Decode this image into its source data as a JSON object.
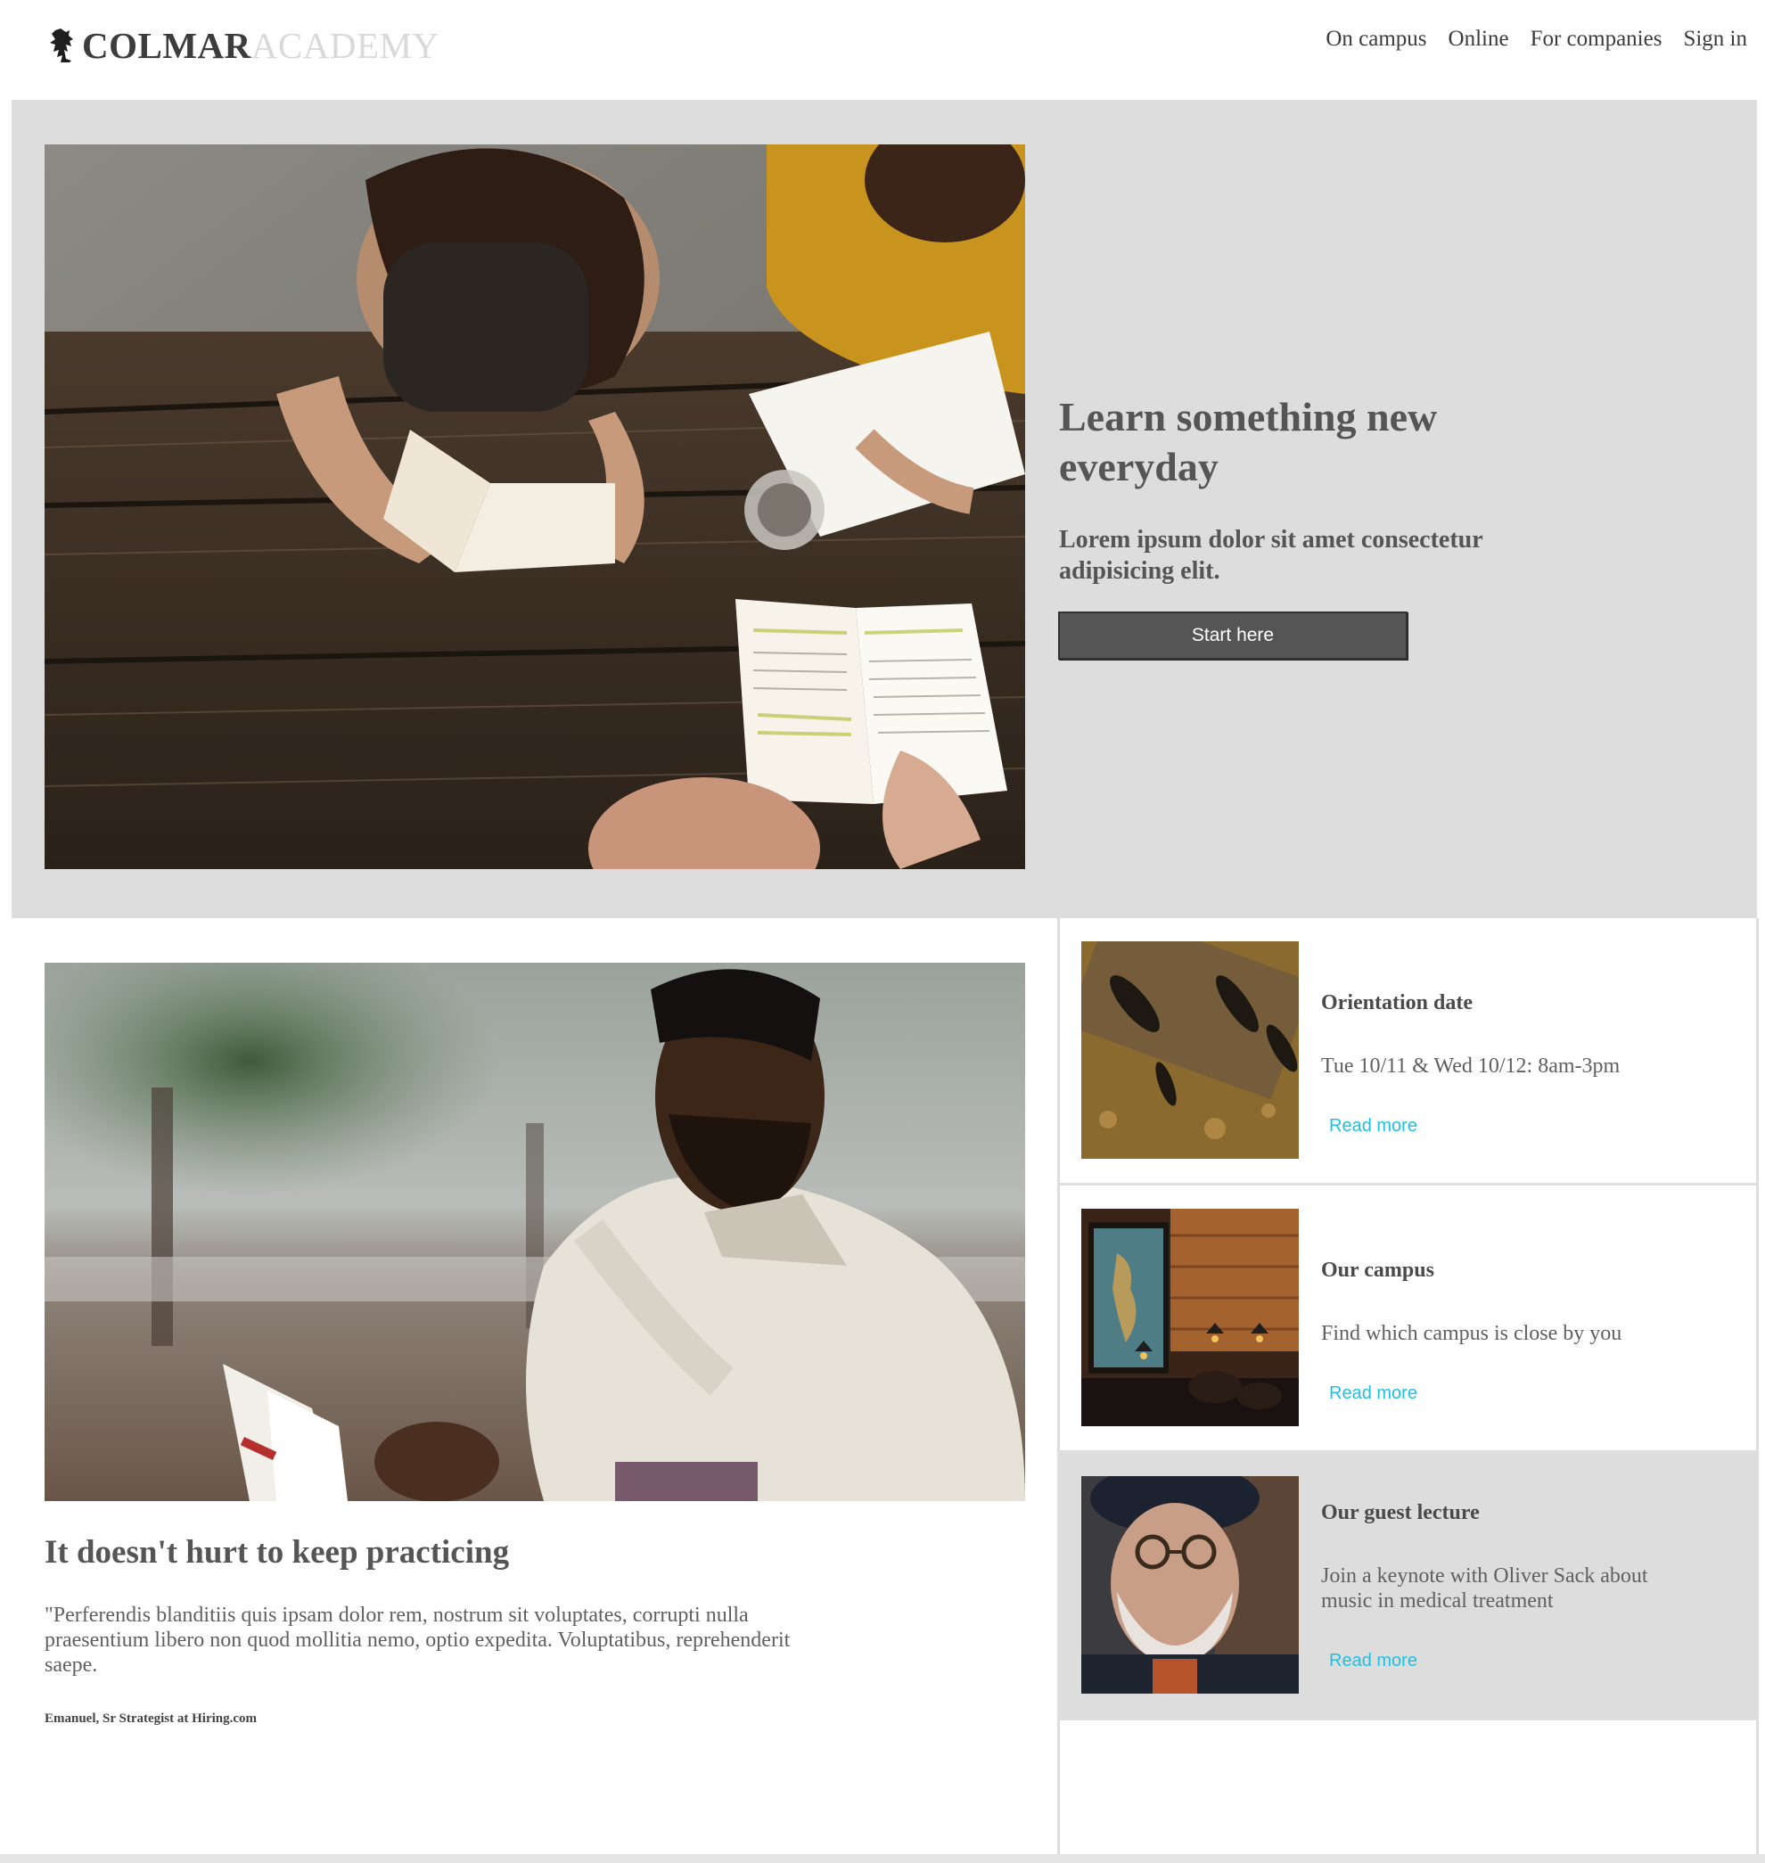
{
  "brand": {
    "name_bold": "COLMAR",
    "name_light": "ACADEMY"
  },
  "nav": {
    "items": [
      {
        "label": "On campus"
      },
      {
        "label": "Online"
      },
      {
        "label": "For companies"
      },
      {
        "label": "Sign in"
      }
    ]
  },
  "hero": {
    "title": "Learn something new everyday",
    "subtitle": "Lorem ipsum dolor sit amet consectetur adipisicing elit.",
    "cta_label": "Start here"
  },
  "article": {
    "title": "It doesn't hurt to keep practicing",
    "quote": "\"Perferendis blanditiis quis ipsam dolor rem, nostrum sit voluptates, corrupti nulla praesentium libero non quod mollitia nemo, optio expedita. Voluptatibus, reprehenderit saepe.",
    "author": "Emanuel, Sr Strategist at Hiring.com"
  },
  "cards": [
    {
      "title": "Orientation date",
      "text": "Tue 10/11 & Wed 10/12: 8am-3pm",
      "link": "Read more"
    },
    {
      "title": "Our campus",
      "text": "Find which campus is close by you",
      "link": "Read more"
    },
    {
      "title": "Our guest lecture",
      "text": "Join a keynote with Oliver Sack about music in medical treatment",
      "link": "Read more"
    }
  ],
  "colors": {
    "link_accent": "#1fc0e0",
    "hero_bg": "#dddddd",
    "button_bg": "#555555"
  }
}
